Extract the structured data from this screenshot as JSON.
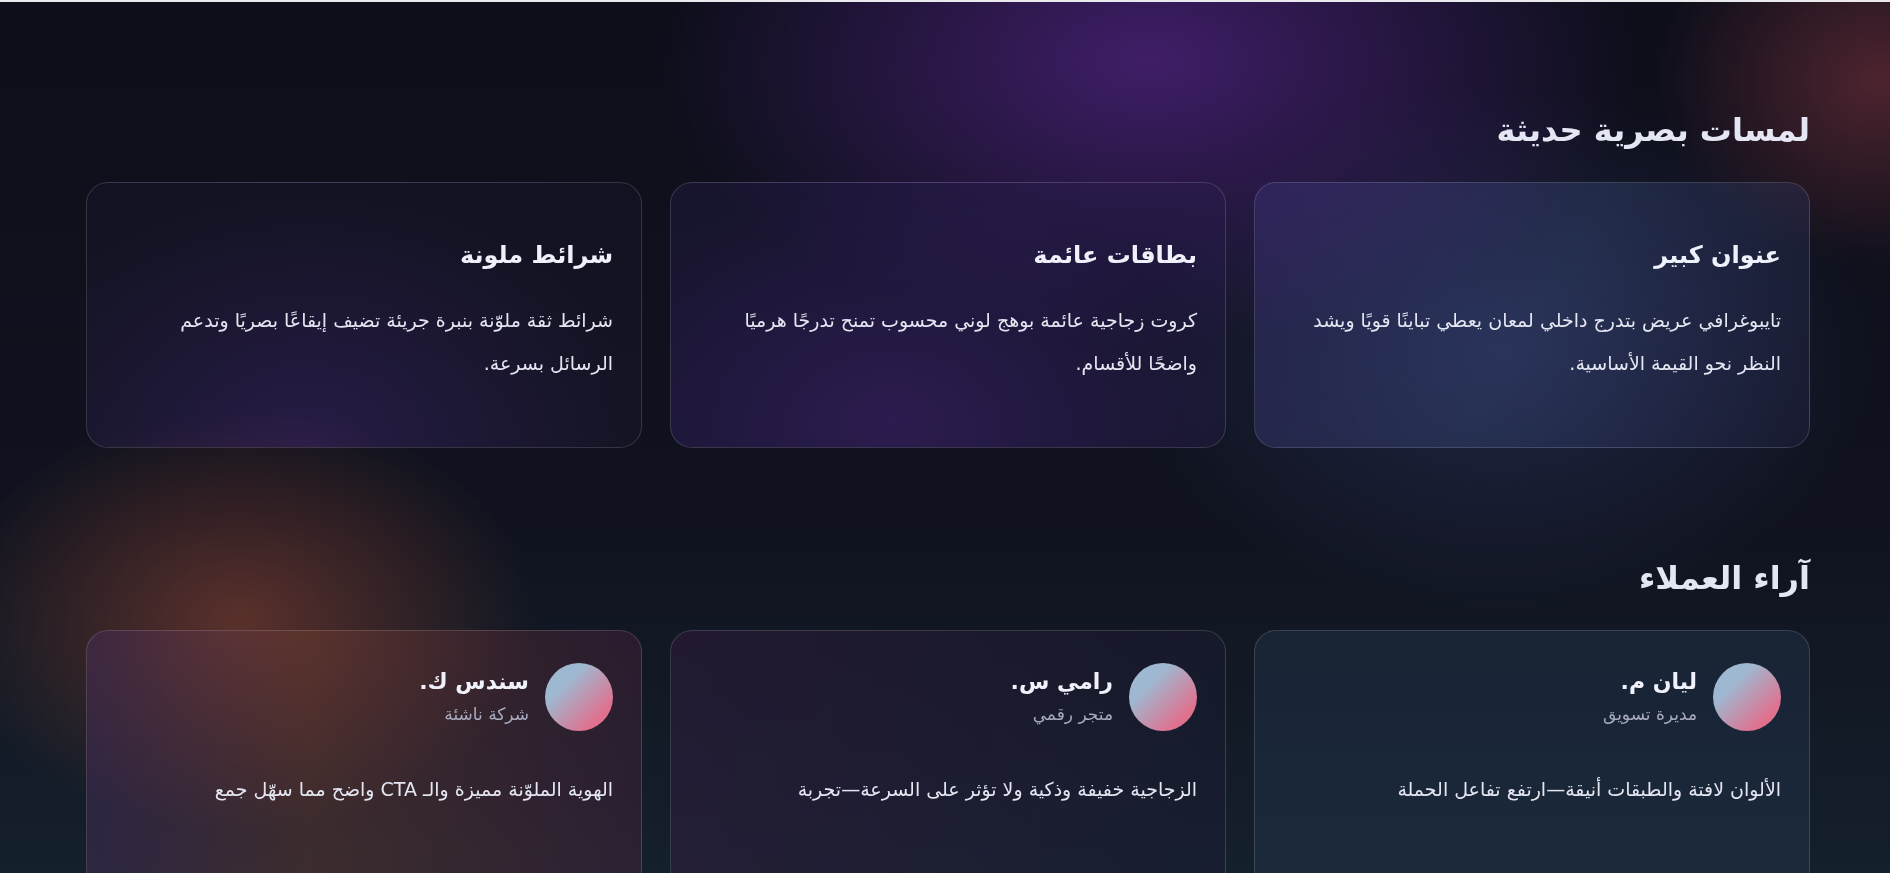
{
  "sections": [
    {
      "title": "لمسات بصرية حديثة",
      "kind": "features",
      "items": [
        {
          "title": "عنوان كبير",
          "text": "تايبوغرافي عريض بتدرج داخلي لمعان يعطي تباينًا قويًا ويشد النظر نحو القيمة الأساسية."
        },
        {
          "title": "بطاقات عائمة",
          "text": "كروت زجاجية عائمة بوهج لوني محسوب تمنح تدرجًا هرميًا واضحًا للأقسام."
        },
        {
          "title": "شرائط ملونة",
          "text": "شرائط ثقة ملوّنة بنبرة جريئة تضيف إيقاعًا بصريًا وتدعم الرسائل بسرعة."
        }
      ]
    },
    {
      "title": "آراء العملاء",
      "kind": "testimonials",
      "items": [
        {
          "name": "ليان م.",
          "role": "مديرة تسويق",
          "text": "الألوان لافتة والطبقات أنيقة—ارتفع تفاعل الحملة"
        },
        {
          "name": "رامي س.",
          "role": "متجر رقمي",
          "text": "الزجاجية خفيفة وذكية ولا تؤثر على السرعة—تجربة"
        },
        {
          "name": "سندس ك.",
          "role": "شركة ناشئة",
          "text": "الهوية الملوّنة مميزة والـ CTA واضح مما سهّل جمع"
        }
      ]
    }
  ]
}
